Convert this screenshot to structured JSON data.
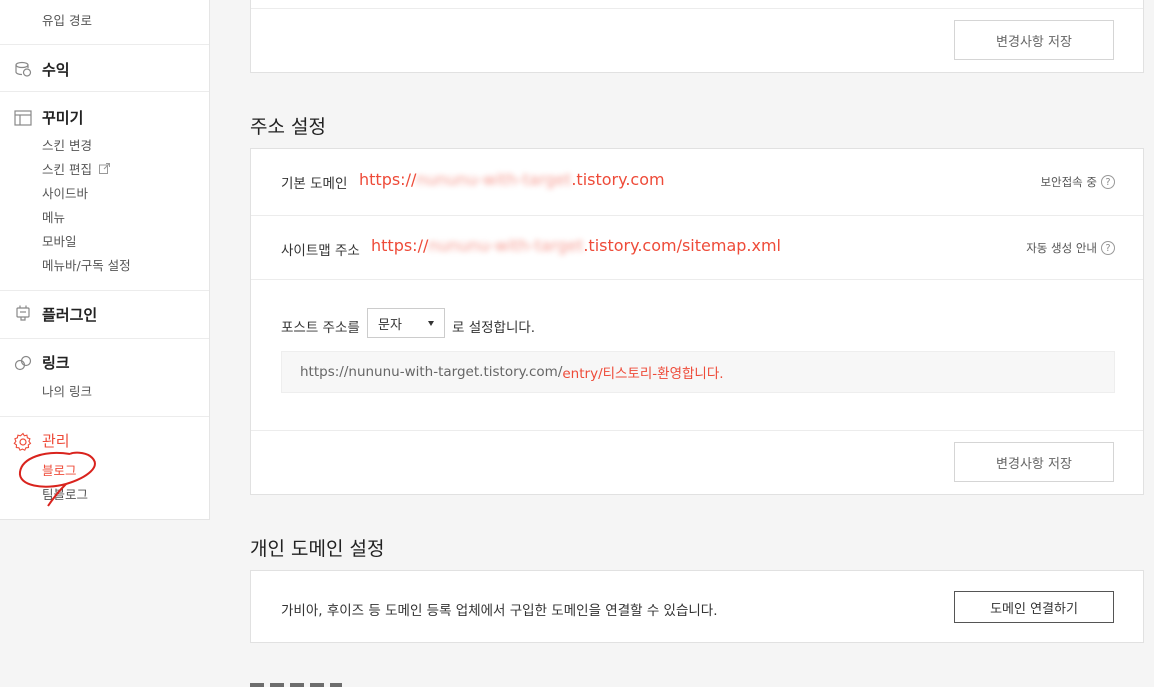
{
  "sidebar": {
    "top_sub": "유입 경로",
    "revenue": "수익",
    "design": {
      "title": "꾸미기",
      "items": [
        "스킨 변경",
        "스킨 편집",
        "사이드바",
        "메뉴",
        "모바일",
        "메뉴바/구독 설정"
      ]
    },
    "plugin": "플러그인",
    "link": {
      "title": "링크",
      "items": [
        "나의 링크"
      ]
    },
    "manage": {
      "title": "관리",
      "items": [
        "블로그",
        "팀블로그"
      ]
    }
  },
  "top_panel": {
    "save_label": "변경사항 저장"
  },
  "address": {
    "title": "주소 설정",
    "default_domain": {
      "label": "기본 도메인",
      "prefix": "https://",
      "blurred": "nununu-with-target",
      "suffix": ".tistory.com",
      "hint": "보안접속 중"
    },
    "sitemap": {
      "label": "사이트맵 주소",
      "prefix": "https://",
      "blurred": "nununu-with-target",
      "suffix": ".tistory.com/sitemap.xml",
      "hint": "자동 생성 안내"
    },
    "post_address": {
      "label": "포스트 주소를",
      "selected": "문자",
      "suffix": "로 설정합니다.",
      "preview_base": "https://nununu-with-target.tistory.com/",
      "preview_path": "entry/티스토리-환영합니다."
    },
    "save_label": "변경사항 저장"
  },
  "personal_domain": {
    "title": "개인 도메인 설정",
    "description": "가비아, 후이즈 등 도메인 등록 업체에서 구입한 도메인을 연결할 수 있습니다.",
    "connect_label": "도메인 연결하기"
  },
  "colors": {
    "accent": "#ee4b39",
    "border": "#e1e1e1",
    "background": "#f5f5f5"
  }
}
